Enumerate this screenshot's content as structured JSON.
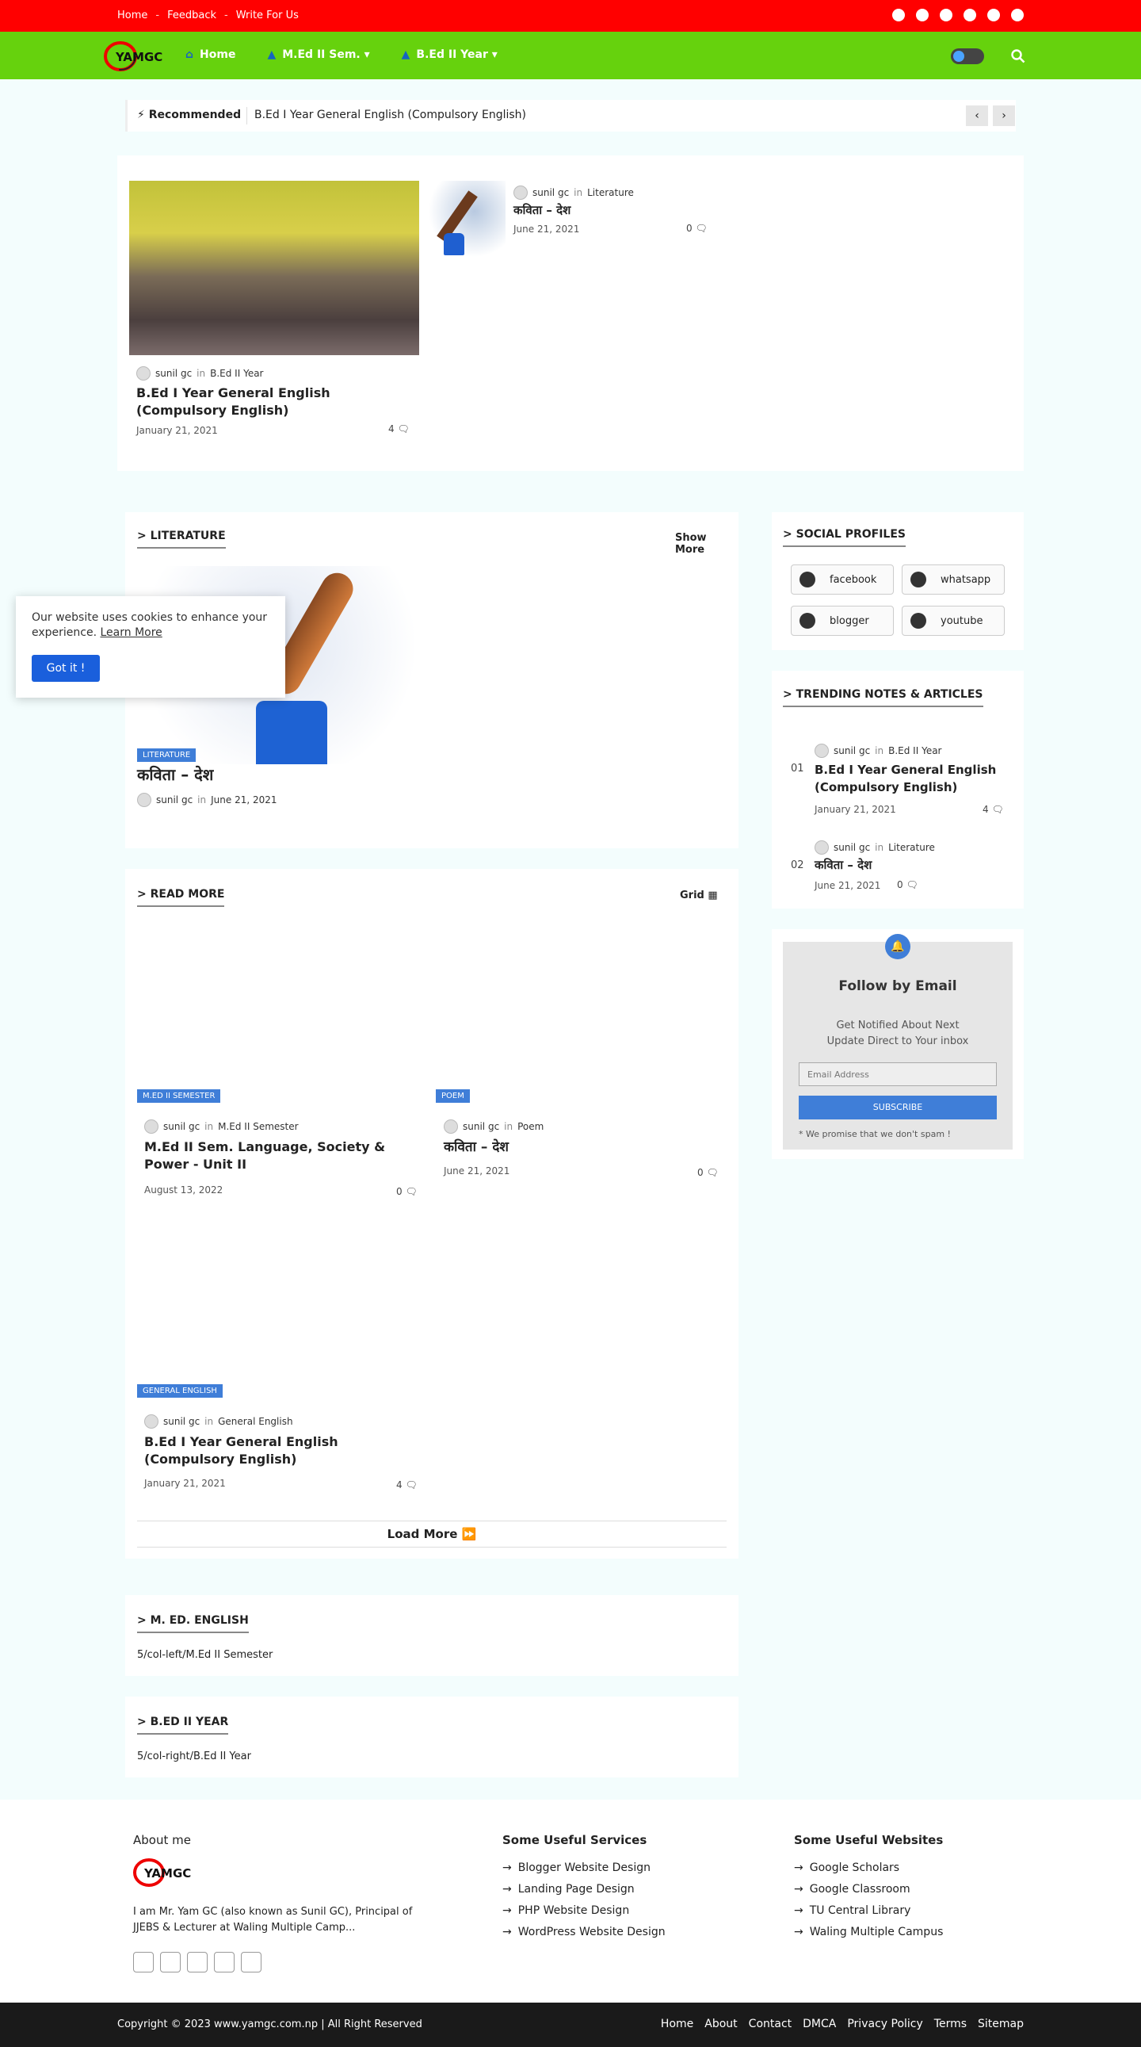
{
  "topbar": {
    "links": [
      "Home",
      "Feedback",
      "Write For Us"
    ],
    "sep": "-"
  },
  "nav": {
    "logo_text": "YAMGC",
    "items": [
      "Home",
      "M.Ed II Sem.",
      "B.Ed II Year"
    ]
  },
  "recommended": {
    "label": "Recommended",
    "text": "B.Ed I Year General English (Compulsory English)"
  },
  "featured": {
    "main": {
      "author": "sunil gc",
      "in": "in",
      "category": "B.Ed II Year",
      "title": "B.Ed I Year General English (Compulsory English)",
      "date": "January 21, 2021",
      "comments": "4"
    },
    "side": {
      "author": "sunil gc",
      "in": "in",
      "category": "Literature",
      "title": "कविता – देश",
      "date": "June 21, 2021",
      "comments": "0"
    }
  },
  "literature": {
    "heading": "LITERATURE",
    "show_more": "Show More",
    "badge": "LITERATURE",
    "title": "कविता – देश",
    "author": "sunil gc",
    "in": "in",
    "date": "June 21, 2021"
  },
  "cookie": {
    "text": "Our website uses cookies to enhance your experience.",
    "link": "Learn More",
    "button": "Got it !"
  },
  "read_more": {
    "heading": "READ MORE",
    "view": "Grid",
    "load_more": "Load More",
    "posts": [
      {
        "badge": "M.ED II SEMESTER",
        "author": "sunil gc",
        "in": "in",
        "category": "M.Ed II Semester",
        "title": "M.Ed II Sem. Language, Society & Power - Unit II",
        "date": "August 13, 2022",
        "comments": "0"
      },
      {
        "badge": "POEM",
        "author": "sunil gc",
        "in": "in",
        "category": "Poem",
        "title": "कविता – देश",
        "date": "June 21, 2021",
        "comments": "0"
      },
      {
        "badge": "GENERAL ENGLISH",
        "author": "sunil gc",
        "in": "in",
        "category": "General English",
        "title": "B.Ed I Year General English (Compulsory English)",
        "date": "January 21, 2021",
        "comments": "4"
      }
    ]
  },
  "med_english": {
    "heading": "M. ED. ENGLISH",
    "text": "5/col-left/M.Ed II Semester"
  },
  "bed_year": {
    "heading": "B.ED II YEAR",
    "text": "5/col-right/B.Ed II Year"
  },
  "social_profiles": {
    "heading": "SOCIAL PROFILES",
    "items": [
      "facebook",
      "whatsapp",
      "blogger",
      "youtube"
    ]
  },
  "trending": {
    "heading": "TRENDING NOTES & ARTICLES",
    "items": [
      {
        "num": "01",
        "author": "sunil gc",
        "in": "in",
        "category": "B.Ed II Year",
        "title": "B.Ed I Year General English (Compulsory English)",
        "date": "January 21, 2021",
        "comments": "4"
      },
      {
        "num": "02",
        "author": "sunil gc",
        "in": "in",
        "category": "Literature",
        "title": "कविता – देश",
        "date": "June 21, 2021",
        "comments": "0"
      }
    ]
  },
  "follow": {
    "title": "Follow by Email",
    "desc1": "Get Notified About Next",
    "desc2": "Update Direct to Your inbox",
    "placeholder": "Email Address",
    "button": "SUBSCRIBE",
    "note": "* We promise that we don't spam !"
  },
  "footer": {
    "about_title": "About me",
    "about_text": "I am Mr. Yam GC (also known as Sunil GC), Principal of JJEBS & Lecturer at Waling Multiple Camp...",
    "services_title": "Some Useful Services",
    "services": [
      "Blogger Website Design",
      "Landing Page Design",
      "PHP Website Design",
      "WordPress Website Design"
    ],
    "websites_title": "Some Useful Websites",
    "websites": [
      "Google Scholars",
      "Google Classroom",
      "TU Central Library",
      "Waling Multiple Campus"
    ],
    "copyright": "Copyright © 2023 www.yamgc.com.np | All Right Reserved",
    "links": [
      "Home",
      "About",
      "Contact",
      "DMCA",
      "Privacy Policy",
      "Terms",
      "Sitemap"
    ]
  },
  "colors": {
    "topbar": "#ff0000",
    "navbar": "#66d20d",
    "accent": "#3f7ed8",
    "footer_bottom": "#1a1a1a"
  }
}
